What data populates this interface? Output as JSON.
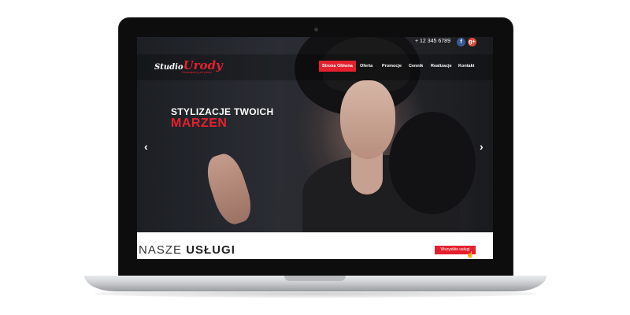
{
  "topbar": {
    "phone": "+ 12 345 6789",
    "facebook_glyph": "f",
    "gplus_glyph": "g+"
  },
  "brand": {
    "name_part1": "Studio",
    "name_part2": "Urody",
    "tagline": "Rozwiązany po plażu"
  },
  "nav": [
    {
      "label": "Strona Główna",
      "active": true
    },
    {
      "label": "Oferta"
    },
    {
      "label": "Promocje"
    },
    {
      "label": "Cennik"
    },
    {
      "label": "Realizacje"
    },
    {
      "label": "Kontakt"
    }
  ],
  "hero": {
    "line1": "STYLIZACJE TWOICH",
    "line2": "MARZEN",
    "prev_arrow": "‹",
    "next_arrow": "›"
  },
  "services": {
    "title_light": "NASZE ",
    "title_bold": "USŁUGI",
    "button": "Wszystkie usługi"
  },
  "colors": {
    "accent": "#e5202e",
    "facebook": "#3b5998",
    "gplus": "#dd4b39"
  },
  "icons": [
    "facebook-icon",
    "google-plus-icon",
    "chevron-left-icon",
    "chevron-right-icon",
    "cursor-icon"
  ]
}
